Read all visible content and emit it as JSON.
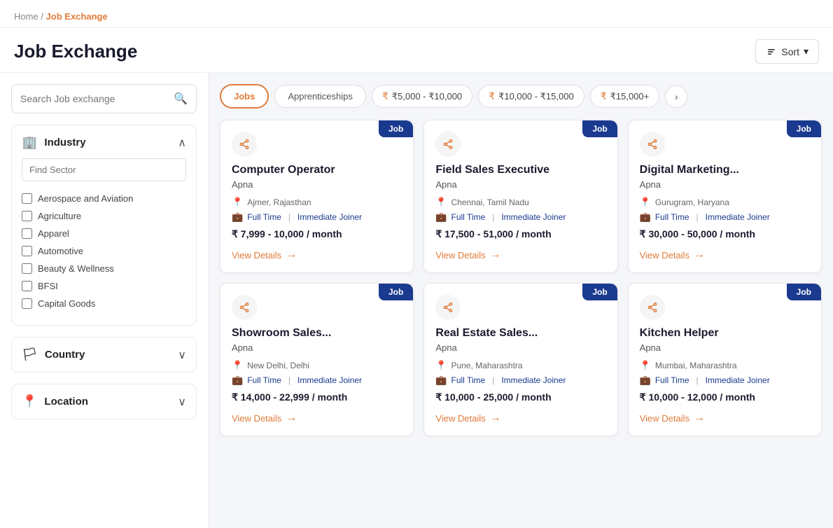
{
  "breadcrumb": {
    "home": "Home",
    "separator": "/",
    "current": "Job Exchange"
  },
  "page": {
    "title": "Job Exchange"
  },
  "sort": {
    "label": "Sort"
  },
  "sidebar": {
    "search": {
      "placeholder": "Search Job exchange"
    },
    "industry": {
      "label": "Industry",
      "sector_placeholder": "Find Sector",
      "sectors": [
        "Aerospace and Aviation",
        "Agriculture",
        "Apparel",
        "Automotive",
        "Beauty & Wellness",
        "BFSI",
        "Capital Goods"
      ]
    },
    "country": {
      "label": "Country"
    },
    "location": {
      "label": "Location"
    }
  },
  "tabs": [
    {
      "label": "Jobs",
      "active": true
    },
    {
      "label": "Apprenticeships",
      "active": false
    }
  ],
  "salary_filters": [
    {
      "label": "₹5,000 - ₹10,000"
    },
    {
      "label": "₹10,000 - ₹15,000"
    },
    {
      "label": "₹15,000+"
    }
  ],
  "jobs": [
    {
      "badge": "Job",
      "title": "Computer Operator",
      "company": "Apna",
      "location": "Ajmer, Rajasthan",
      "type": "Full Time",
      "joiner": "Immediate Joiner",
      "salary": "₹ 7,999 - 10,000 / month",
      "view_details": "View Details"
    },
    {
      "badge": "Job",
      "title": "Field Sales Executive",
      "company": "Apna",
      "location": "Chennai, Tamil Nadu",
      "type": "Full Time",
      "joiner": "Immediate Joiner",
      "salary": "₹ 17,500 - 51,000 / month",
      "view_details": "View Details"
    },
    {
      "badge": "Job",
      "title": "Digital Marketing...",
      "company": "Apna",
      "location": "Gurugram, Haryana",
      "type": "Full Time",
      "joiner": "Immediate Joiner",
      "salary": "₹ 30,000 - 50,000 / month",
      "view_details": "View Details"
    },
    {
      "badge": "Job",
      "title": "Showroom Sales...",
      "company": "Apna",
      "location": "New Delhi, Delhi",
      "type": "Full Time",
      "joiner": "Immediate Joiner",
      "salary": "₹ 14,000 - 22,999 / month",
      "view_details": "View Details"
    },
    {
      "badge": "Job",
      "title": "Real Estate Sales...",
      "company": "Apna",
      "location": "Pune, Maharashtra",
      "type": "Full Time",
      "joiner": "Immediate Joiner",
      "salary": "₹ 10,000 - 25,000 / month",
      "view_details": "View Details"
    },
    {
      "badge": "Job",
      "title": "Kitchen Helper",
      "company": "Apna",
      "location": "Mumbai, Maharashtra",
      "type": "Full Time",
      "joiner": "Immediate Joiner",
      "salary": "₹ 10,000 - 12,000 / month",
      "view_details": "View Details"
    }
  ]
}
